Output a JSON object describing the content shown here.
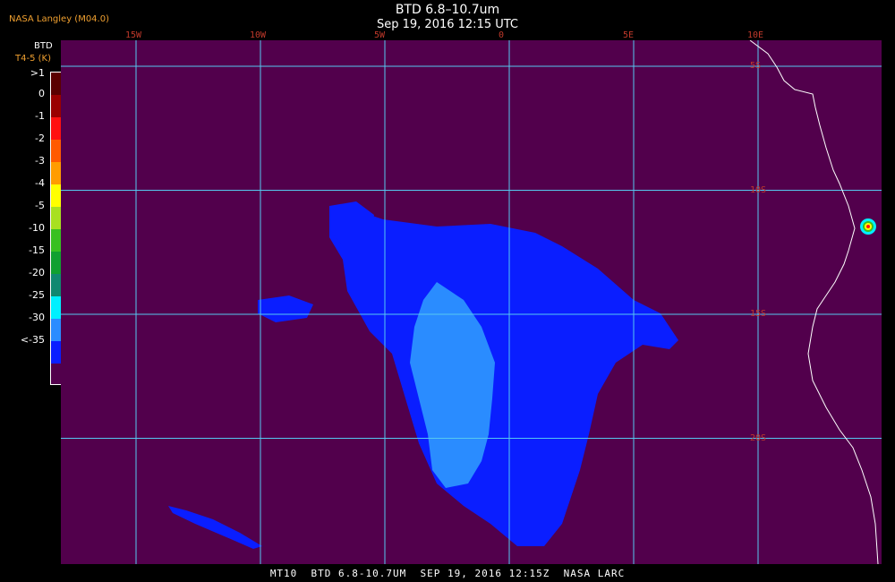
{
  "header": {
    "title": "BTD 6.8–10.7um",
    "date": "Sep 19, 2016 12:15 UTC"
  },
  "provider": "NASA Langley (M04.0)",
  "legend": {
    "heading": "BTD",
    "units": "T4-5 (K)",
    "items": [
      {
        "label": ">1",
        "color": "#5a0000"
      },
      {
        "label": "0",
        "color": "#9a0000"
      },
      {
        "label": "-1",
        "color": "#ff1010"
      },
      {
        "label": "-2",
        "color": "#ff5a00"
      },
      {
        "label": "-3",
        "color": "#ff9c00"
      },
      {
        "label": "-4",
        "color": "#ffff00"
      },
      {
        "label": "-5",
        "color": "#a8e020"
      },
      {
        "label": "-10",
        "color": "#38c020"
      },
      {
        "label": "-15",
        "color": "#10a030"
      },
      {
        "label": "-20",
        "color": "#108870"
      },
      {
        "label": "-25",
        "color": "#00f0ff"
      },
      {
        "label": "-30",
        "color": "#2a8cff"
      },
      {
        "label": "<-35",
        "color": "#0a1eff"
      }
    ],
    "bottom_color": "#52004c"
  },
  "map": {
    "background": "#52004c",
    "grid_color": "#55c8f0",
    "coast_color": "#ffffff",
    "lon_labels": [
      {
        "label": "15W",
        "lon": -15
      },
      {
        "label": "10W",
        "lon": -10
      },
      {
        "label": "5W",
        "lon": -5
      },
      {
        "label": "0",
        "lon": 0
      },
      {
        "label": "5E",
        "lon": 5
      },
      {
        "label": "10E",
        "lon": 10
      }
    ],
    "lat_labels": [
      {
        "label": "5S",
        "lat": -5
      },
      {
        "label": "10S",
        "lat": -10
      },
      {
        "label": "15S",
        "lat": -15
      },
      {
        "label": "20S",
        "lat": -20
      }
    ]
  },
  "footer": "MT10  BTD 6.8-10.7UM  SEP 19, 2016 12:15Z  NASA LARC"
}
